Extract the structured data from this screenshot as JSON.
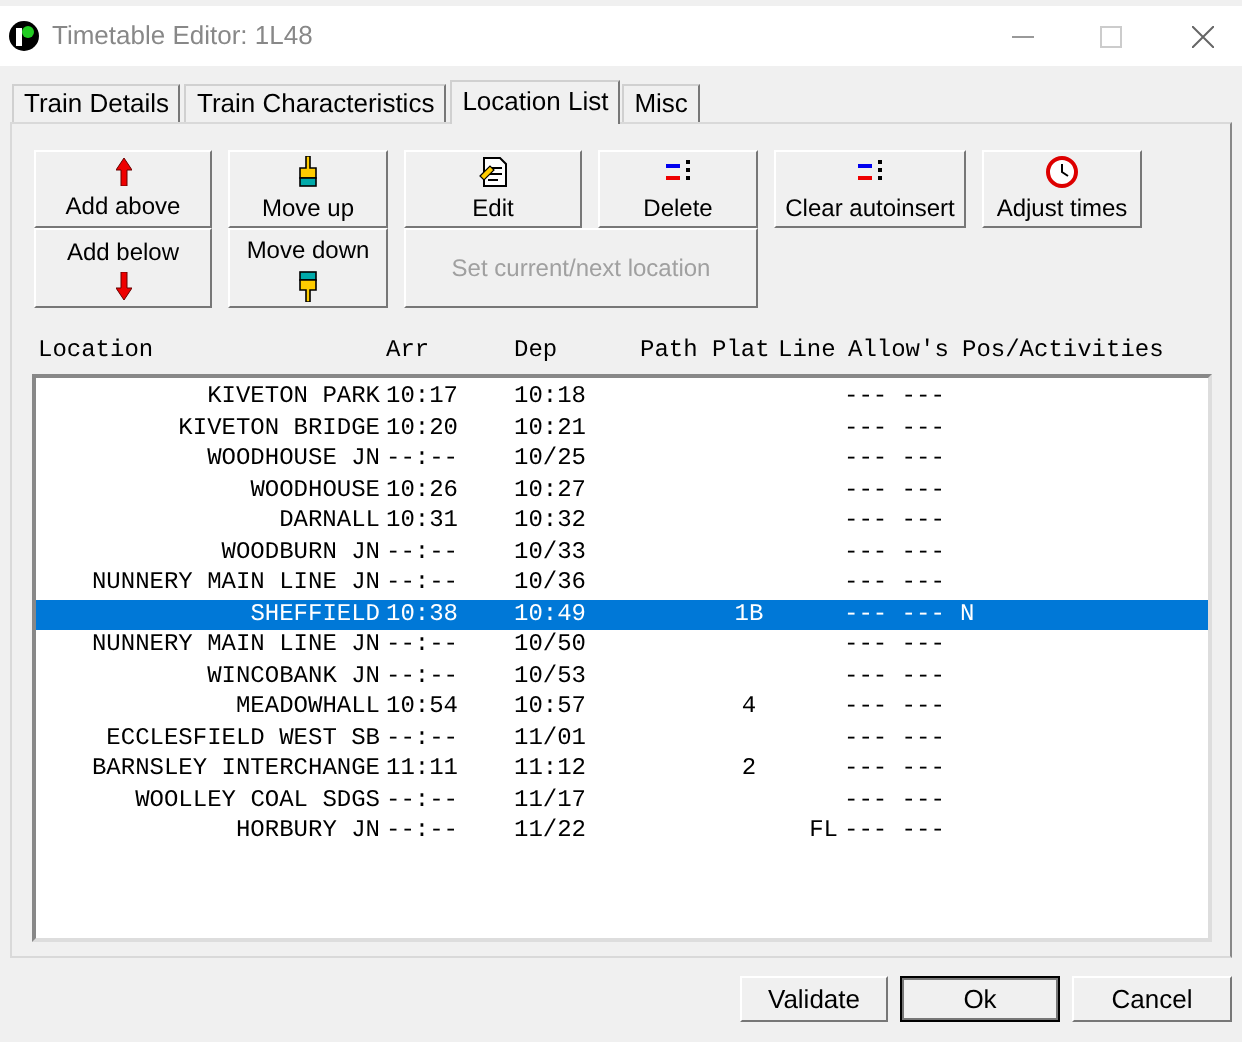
{
  "window": {
    "title": "Timetable Editor: 1L48"
  },
  "tabs": [
    {
      "label": "Train Details",
      "selected": false
    },
    {
      "label": "Train Characteristics",
      "selected": false
    },
    {
      "label": "Location List",
      "selected": true
    },
    {
      "label": "Misc",
      "selected": false
    }
  ],
  "toolbar": [
    {
      "label": "Add above",
      "kind": "up",
      "disabled": false
    },
    {
      "label": "Add below",
      "kind": "down",
      "disabled": false
    },
    {
      "label": "Move up",
      "kind": "hand",
      "disabled": false
    },
    {
      "label": "Move down",
      "kind": "handdown",
      "disabled": false
    },
    {
      "label": "Edit",
      "kind": "edit",
      "disabled": false
    },
    {
      "label": "Delete",
      "kind": "delete",
      "disabled": false
    },
    {
      "label": "Set current/next location",
      "kind": "plain",
      "disabled": true
    },
    {
      "label": "Clear autoinsert",
      "kind": "clear",
      "disabled": false
    },
    {
      "label": "Adjust times",
      "kind": "clock",
      "disabled": false
    }
  ],
  "table": {
    "columns": [
      "Location",
      "Arr",
      "Dep",
      "Path",
      "Plat",
      "Line",
      "Allow's",
      "Pos/Activities"
    ],
    "rows": [
      {
        "location": "KIVETON PARK",
        "arr": "10:17",
        "dep": "10:18",
        "allowances": "--- ---",
        "selected": false
      },
      {
        "location": "KIVETON BRIDGE",
        "arr": "10:20",
        "dep": "10:21",
        "allowances": "--- ---",
        "selected": false
      },
      {
        "location": "WOODHOUSE JN",
        "arr": "--:--",
        "dep": "10/25",
        "allowances": "--- ---",
        "selected": false
      },
      {
        "location": "WOODHOUSE",
        "arr": "10:26",
        "dep": "10:27",
        "allowances": "--- ---",
        "selected": false
      },
      {
        "location": "DARNALL",
        "arr": "10:31",
        "dep": "10:32",
        "allowances": "--- ---",
        "selected": false
      },
      {
        "location": "WOODBURN JN",
        "arr": "--:--",
        "dep": "10/33",
        "allowances": "--- ---",
        "selected": false
      },
      {
        "location": "NUNNERY MAIN LINE JN",
        "arr": "--:--",
        "dep": "10/36",
        "allowances": "--- ---",
        "selected": false
      },
      {
        "location": "SHEFFIELD",
        "arr": "10:38",
        "dep": "10:49",
        "plat": "1B",
        "allowances": "--- ---",
        "pos": "N",
        "selected": true
      },
      {
        "location": "NUNNERY MAIN LINE JN",
        "arr": "--:--",
        "dep": "10/50",
        "allowances": "--- ---",
        "selected": false
      },
      {
        "location": "WINCOBANK JN",
        "arr": "--:--",
        "dep": "10/53",
        "allowances": "--- ---",
        "selected": false
      },
      {
        "location": "MEADOWHALL",
        "arr": "10:54",
        "dep": "10:57",
        "plat": "4",
        "allowances": "--- ---",
        "selected": false
      },
      {
        "location": "ECCLESFIELD WEST SB",
        "arr": "--:--",
        "dep": "11/01",
        "allowances": "--- ---",
        "selected": false
      },
      {
        "location": "BARNSLEY INTERCHANGE",
        "arr": "11:11",
        "dep": "11:12",
        "plat": "2",
        "allowances": "--- ---",
        "selected": false
      },
      {
        "location": "WOOLLEY COAL SDGS",
        "arr": "--:--",
        "dep": "11/17",
        "allowances": "--- ---",
        "selected": false
      },
      {
        "location": "HORBURY JN",
        "arr": "--:--",
        "dep": "11/22",
        "line": "FL",
        "allowances": "--- ---",
        "selected": false
      }
    ]
  },
  "buttons": [
    {
      "label": "Validate",
      "default": false
    },
    {
      "label": "Ok",
      "default": true
    },
    {
      "label": "Cancel",
      "default": false
    }
  ]
}
